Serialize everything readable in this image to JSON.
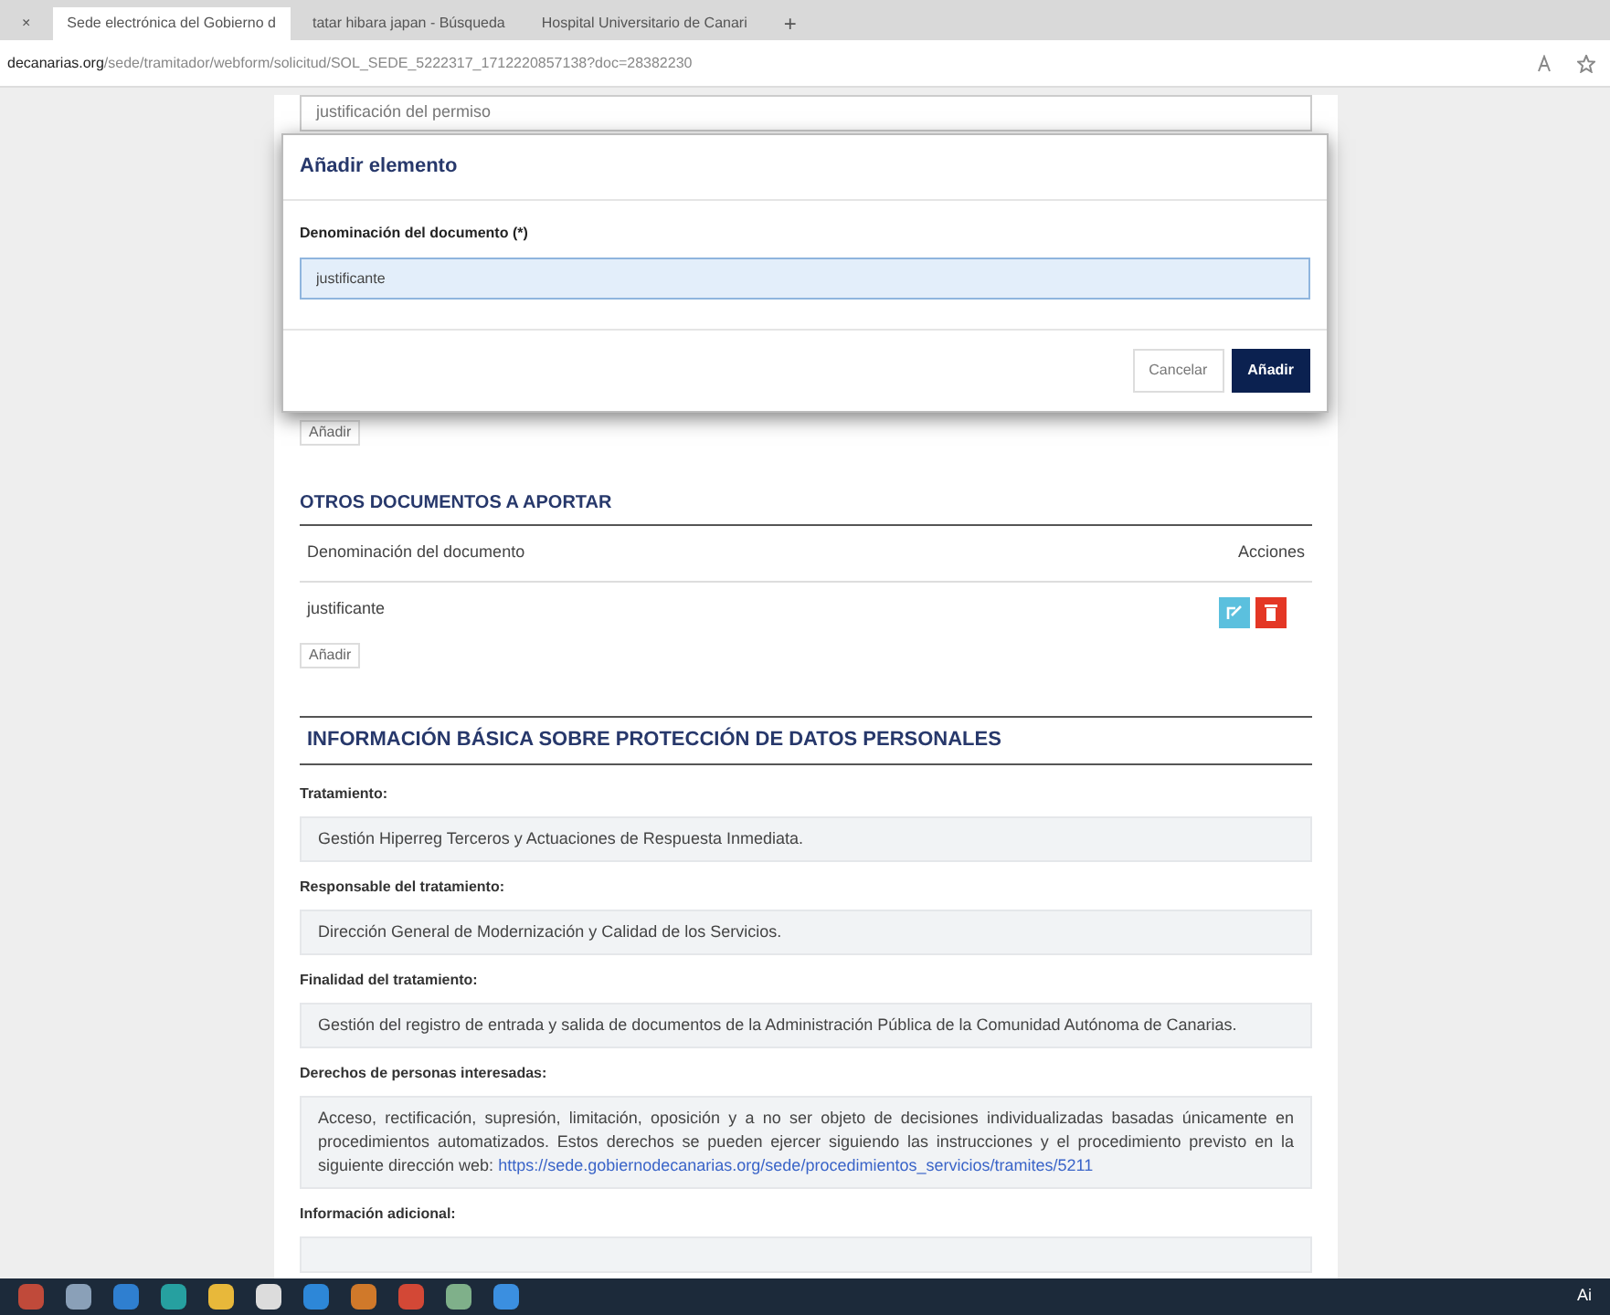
{
  "browser": {
    "tabs": [
      {
        "label": "×",
        "selected": false
      },
      {
        "label": "Sede electrónica del Gobierno d",
        "selected": true
      },
      {
        "label": "tatar hibara japan - Búsqueda",
        "selected": false
      },
      {
        "label": "Hospital Universitario de Canari",
        "selected": false
      }
    ],
    "new_tab": "+",
    "address": {
      "host": "decanarias.org",
      "path": "/sede/tramitador/webform/solicitud/SOL_SEDE_5222317_1712220857138?doc=28382230"
    }
  },
  "page": {
    "field_above": "justificación del permiso",
    "add_button_1": "Añadir",
    "other_docs": {
      "heading": "OTROS DOCUMENTOS A APORTAR",
      "columns": [
        "Denominación del documento",
        "Acciones"
      ],
      "rows": [
        {
          "name": "justificante"
        }
      ],
      "add_button": "Añadir"
    },
    "privacy": {
      "heading": "INFORMACIÓN BÁSICA SOBRE PROTECCIÓN DE DATOS PERSONALES",
      "items": [
        {
          "label": "Tratamiento:",
          "text": "Gestión Hiperreg Terceros y Actuaciones de Respuesta Inmediata."
        },
        {
          "label": "Responsable del tratamiento:",
          "text": "Dirección General de Modernización y Calidad de los Servicios."
        },
        {
          "label": "Finalidad del tratamiento:",
          "text": "Gestión del registro de entrada y salida de documentos de la Administración Pública de la Comunidad Autónoma de Canarias."
        },
        {
          "label": "Derechos de personas interesadas:",
          "text": "Acceso, rectificación, supresión, limitación, oposición y a no ser objeto de decisiones individualizadas basadas únicamente en procedimientos automatizados. Estos derechos se pueden ejercer siguiendo las instrucciones y el procedimiento previsto en la siguiente dirección web:",
          "link": "https://sede.gobiernodecanarias.org/sede/procedimientos_servicios/tramites/5211"
        },
        {
          "label": "Información adicional:"
        }
      ]
    }
  },
  "modal": {
    "title": "Añadir elemento",
    "field_label": "Denominación del documento (*)",
    "field_value": "justificante",
    "buttons": [
      {
        "label": "Cancelar",
        "kind": "secondary"
      },
      {
        "label": "Añadir",
        "kind": "primary"
      }
    ]
  },
  "taskbar": {
    "tray_text": "Ai"
  }
}
